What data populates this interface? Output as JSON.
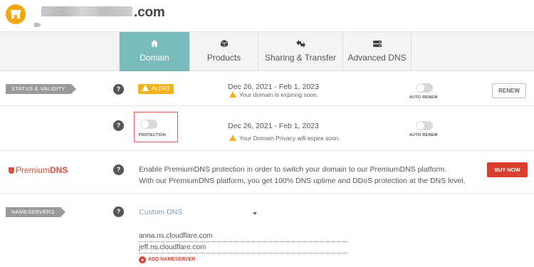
{
  "header": {
    "domain_suffix": ".com"
  },
  "tabs": [
    {
      "label": "Domain",
      "icon": "home-icon"
    },
    {
      "label": "Products",
      "icon": "box-icon"
    },
    {
      "label": "Sharing & Transfer",
      "icon": "transfer-icon"
    },
    {
      "label": "Advanced DNS",
      "icon": "server-icon"
    }
  ],
  "status": {
    "section_label": "STATUS & VALIDITY",
    "help": "?",
    "alert_label": "ALERT",
    "date_range": "Dec 26, 2021 - Feb 1, 2023",
    "note": "Your domain is expiring soon.",
    "toggle_label": "AUTO-RENEW",
    "renew_button": "RENEW"
  },
  "privacy": {
    "help": "?",
    "protection_label": "PROTECTION",
    "date_range": "Dec 26, 2021 - Feb 1, 2023",
    "note": "Your Domain Privacy will expire soon.",
    "toggle_label": "AUTO-RENEW"
  },
  "premium": {
    "logo_prefix": "Premium",
    "logo_bold": "DNS",
    "help": "?",
    "line1": "Enable PremiumDNS protection in order to switch your domain to our PremiumDNS platform.",
    "line2": "With our PremiumDNS platform, you get 100% DNS uptime and DDoS protection at the DNS level.",
    "buy_button": "BUY NOW"
  },
  "nameservers": {
    "section_label": "NAMESERVERS",
    "help": "?",
    "selected": "Custom DNS",
    "servers": [
      "anna.ns.cloudflare.com",
      "jeff.ns.cloudflare.com"
    ],
    "add_label": "ADD NAMESERVER"
  },
  "colors": {
    "accent": "#7abcbb",
    "alert": "#f3b11b",
    "brand_red": "#d93f2e",
    "logo": "#f0a80e"
  }
}
